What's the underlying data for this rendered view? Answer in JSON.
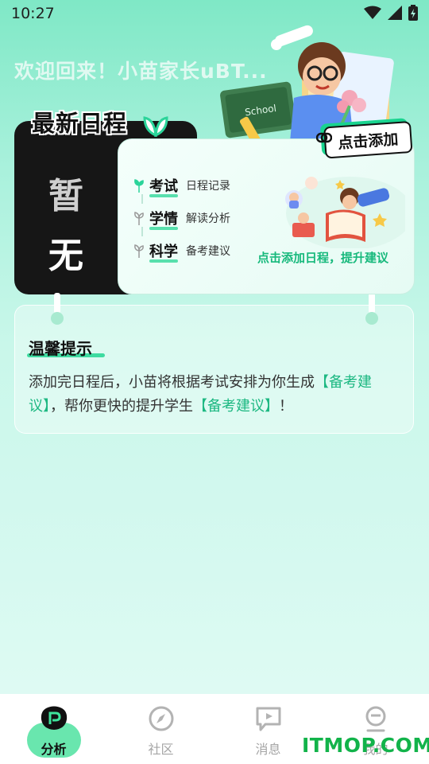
{
  "status_bar": {
    "time": "10:27"
  },
  "header": {
    "welcome": "欢迎回来！小苗家长uBT..."
  },
  "schedule": {
    "tab_title": "最新日程",
    "add_button": "点击添加",
    "empty_chars": [
      "暂",
      "无"
    ],
    "features": [
      {
        "main": "考试",
        "sub": "日程记录"
      },
      {
        "main": "学情",
        "sub": "解读分析"
      },
      {
        "main": "科学",
        "sub": "备考建议"
      }
    ],
    "hint": "点击添加日程，提升建议"
  },
  "tip": {
    "title": "温馨提示",
    "body_part1": "添加完日程后，小苗将根据考试安排为你生成",
    "highlight1": "【备考建议】",
    "body_part2": "，帮你更快的提升学生",
    "highlight2": "【备考建议】",
    "body_part3": "！"
  },
  "nav": {
    "items": [
      {
        "label": "分析",
        "icon": "analysis-icon",
        "active": true
      },
      {
        "label": "社区",
        "icon": "compass-icon",
        "active": false
      },
      {
        "label": "消息",
        "icon": "message-icon",
        "active": false
      },
      {
        "label": "我的",
        "icon": "profile-icon",
        "active": false
      }
    ]
  },
  "watermark": "ITMOP.COM",
  "colors": {
    "accent": "#19d48f",
    "highlight": "#1db882",
    "dark": "#161616"
  }
}
